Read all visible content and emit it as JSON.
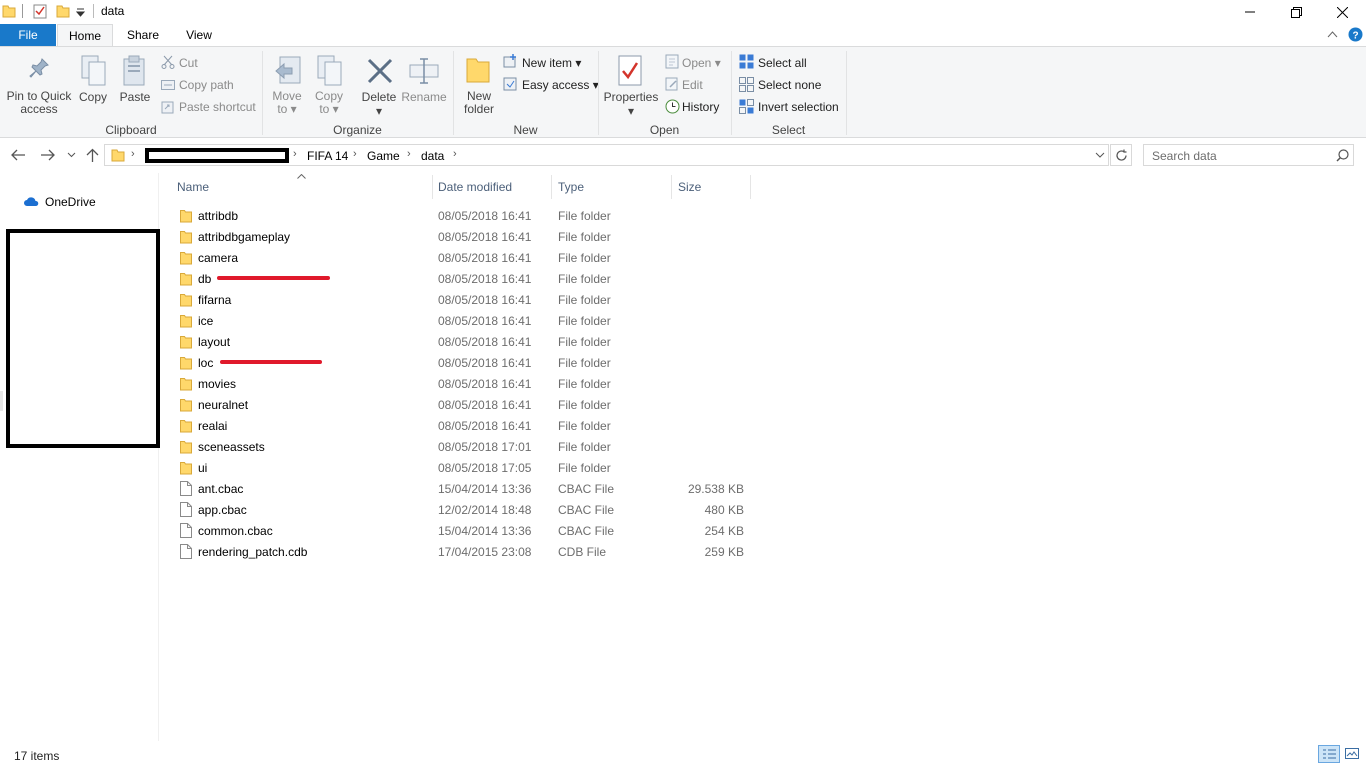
{
  "window": {
    "title": "data"
  },
  "tabs": {
    "file": "File",
    "home": "Home",
    "share": "Share",
    "view": "View"
  },
  "ribbon": {
    "clipboard": {
      "pin_line1": "Pin to Quick",
      "pin_line2": "access",
      "copy": "Copy",
      "paste": "Paste",
      "cut": "Cut",
      "copy_path": "Copy path",
      "paste_shortcut": "Paste shortcut",
      "group": "Clipboard"
    },
    "organize": {
      "move_line1": "Move",
      "move_line2": "to",
      "copy_line1": "Copy",
      "copy_line2": "to",
      "delete": "Delete",
      "rename": "Rename",
      "group": "Organize"
    },
    "new": {
      "folder_line1": "New",
      "folder_line2": "folder",
      "new_item": "New item",
      "easy_access": "Easy access",
      "group": "New"
    },
    "open": {
      "properties": "Properties",
      "open": "Open",
      "edit": "Edit",
      "history": "History",
      "group": "Open"
    },
    "select": {
      "select_all": "Select all",
      "select_none": "Select none",
      "invert": "Invert selection",
      "group": "Select"
    }
  },
  "address": {
    "crumbs": [
      "FIFA 14",
      "Game",
      "data"
    ],
    "search_placeholder": "Search data"
  },
  "nav": {
    "onedrive": "OneDrive"
  },
  "columns": {
    "name": "Name",
    "date": "Date modified",
    "type": "Type",
    "size": "Size"
  },
  "files": [
    {
      "name": "attribdb",
      "date": "08/05/2018 16:41",
      "type": "File folder",
      "size": "",
      "kind": "folder"
    },
    {
      "name": "attribdbgameplay",
      "date": "08/05/2018 16:41",
      "type": "File folder",
      "size": "",
      "kind": "folder"
    },
    {
      "name": "camera",
      "date": "08/05/2018 16:41",
      "type": "File folder",
      "size": "",
      "kind": "folder"
    },
    {
      "name": "db",
      "date": "08/05/2018 16:41",
      "type": "File folder",
      "size": "",
      "kind": "folder"
    },
    {
      "name": "fifarna",
      "date": "08/05/2018 16:41",
      "type": "File folder",
      "size": "",
      "kind": "folder"
    },
    {
      "name": "ice",
      "date": "08/05/2018 16:41",
      "type": "File folder",
      "size": "",
      "kind": "folder"
    },
    {
      "name": "layout",
      "date": "08/05/2018 16:41",
      "type": "File folder",
      "size": "",
      "kind": "folder"
    },
    {
      "name": "loc",
      "date": "08/05/2018 16:41",
      "type": "File folder",
      "size": "",
      "kind": "folder"
    },
    {
      "name": "movies",
      "date": "08/05/2018 16:41",
      "type": "File folder",
      "size": "",
      "kind": "folder"
    },
    {
      "name": "neuralnet",
      "date": "08/05/2018 16:41",
      "type": "File folder",
      "size": "",
      "kind": "folder"
    },
    {
      "name": "realai",
      "date": "08/05/2018 16:41",
      "type": "File folder",
      "size": "",
      "kind": "folder"
    },
    {
      "name": "sceneassets",
      "date": "08/05/2018 17:01",
      "type": "File folder",
      "size": "",
      "kind": "folder"
    },
    {
      "name": "ui",
      "date": "08/05/2018 17:05",
      "type": "File folder",
      "size": "",
      "kind": "folder"
    },
    {
      "name": "ant.cbac",
      "date": "15/04/2014 13:36",
      "type": "CBAC File",
      "size": "29.538 KB",
      "kind": "file"
    },
    {
      "name": "app.cbac",
      "date": "12/02/2014 18:48",
      "type": "CBAC File",
      "size": "480 KB",
      "kind": "file"
    },
    {
      "name": "common.cbac",
      "date": "15/04/2014 13:36",
      "type": "CBAC File",
      "size": "254 KB",
      "kind": "file"
    },
    {
      "name": "rendering_patch.cdb",
      "date": "17/04/2015 23:08",
      "type": "CDB File",
      "size": "259 KB",
      "kind": "file"
    }
  ],
  "status": {
    "items": "17 items"
  },
  "colors": {
    "accent": "#1979ca",
    "folder": "#ffd86b",
    "annotation": "#e0192b"
  }
}
